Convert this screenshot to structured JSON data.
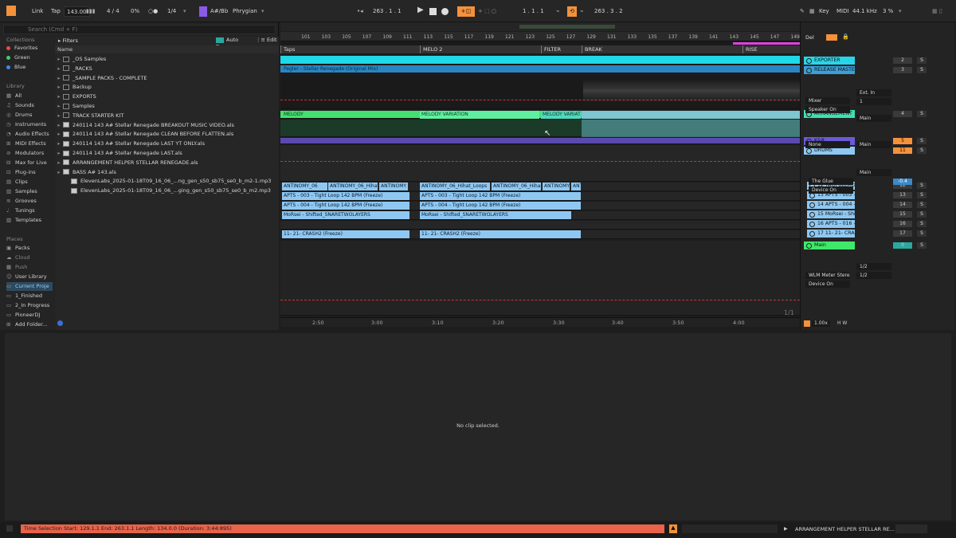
{
  "topbar": {
    "link": "Link",
    "tap": "Tap",
    "tempo": "143.00",
    "signature": "4 / 4",
    "cpu_pct": "0%",
    "quantize": "1/4",
    "key_root": "A#/Bb",
    "scale": "Phrygian",
    "song_position": "263 .  1 .  1",
    "loop_start": "1 .  1 .  1",
    "loop_length": "263 .  3 .  2",
    "key_label": "Key",
    "midi_label": "MIDI",
    "sample_rate": "44.1 kHz",
    "zoom": "3 %"
  },
  "browser": {
    "search_placeholder": "Search (Cmd + F)",
    "filters_label": "Filters",
    "auto_tags": "Auto Tags",
    "edit": "Edit",
    "name_header": "Name",
    "collections_title": "Collections",
    "collections": [
      {
        "label": "Favorites",
        "color": "#e84a4a"
      },
      {
        "label": "Green",
        "color": "#3ecf6e"
      },
      {
        "label": "Blue",
        "color": "#3c8ae8"
      }
    ],
    "library_title": "Library",
    "library": [
      "All",
      "Sounds",
      "Drums",
      "Instruments",
      "Audio Effects",
      "MIDI Effects",
      "Modulators",
      "Max for Live",
      "Plug-ins",
      "Clips",
      "Samples",
      "Grooves",
      "Tunings",
      "Templates"
    ],
    "places_title": "Places",
    "places": [
      "Packs",
      "Cloud",
      "Push",
      "User Library",
      "Current Proje",
      "1_Finished",
      "2_In Progress",
      "PioneerDJ",
      "Add Folder..."
    ],
    "files": [
      "_OS Samples",
      "_RACKS",
      "_SAMPLE PACKS - COMPLETE",
      "Backup",
      "EXPORTS",
      "Samples",
      "TRACK STARTER KIT",
      "240114 143 A# Stellar Renegade BREAKOUT MUSIC VIDEO.als",
      "240114 143 A# Stellar Renegade CLEAN BEFORE FLATTEN.als",
      "240114 143 A# Stellar Renegade LAST YT ONLY.als",
      "240114 143 A# Stellar Renegade LAST.als",
      "ARRANGEMENT HELPER STELLAR RENEGADE.als",
      "BASS A# 143.als",
      "ElevenLabs_2025-01-18T09_16_06_...ng_gen_s50_sb75_se0_b_m2-1.mp3",
      "ElevenLabs_2025-01-18T09_16_06_...ging_gen_s50_sb75_se0_b_m2.mp3"
    ]
  },
  "arrangement": {
    "bars": [
      "101",
      "103",
      "105",
      "107",
      "109",
      "111",
      "113",
      "115",
      "117",
      "119",
      "121",
      "123",
      "125",
      "127",
      "129",
      "131",
      "133",
      "135",
      "137",
      "139",
      "141",
      "143",
      "145",
      "147",
      "149"
    ],
    "locators": [
      {
        "label": "Taps"
      },
      {
        "label": "MELO 2"
      },
      {
        "label": "FILTER"
      },
      {
        "label": "BREAK"
      },
      {
        "label": "RISE"
      }
    ],
    "audio_clip": "Pegler - Stellar Renegade (Original Mix)",
    "melody_clips": [
      "MELODY",
      "MELODY VARIATION",
      "MELODY VARIAT"
    ],
    "clip_rows": [
      [
        "ANTINOMY_06",
        "ANTINOMY_06_Hihat",
        "ANTINOMY",
        "ANTINOMY_06_Hihat_Loops",
        "ANTINOMY_06_Hiha",
        "ANTINOMY",
        "ANT"
      ],
      [
        "APTS - 003 - Tight Loop 142 BPM  (Freeze)",
        "APTS - 003 - Tight Loop 142 BPM  (Freeze)"
      ],
      [
        "APTS - 004 - Tight Loop 142 BPM  (Freeze)",
        "APTS - 004 - Tight Loop 142 BPM  (Freeze)"
      ],
      [
        "MoRsei - Shifted_SNARETWOLAYERS",
        "MoRsei - Shifted_SNARETWOLAYERS"
      ],
      [
        "11- 21- CRASH2 (Freeze)",
        "11- 21- CRASH2 (Freeze)"
      ]
    ],
    "times": [
      "2:50",
      "3:00",
      "3:10",
      "3:20",
      "3:30",
      "3:40",
      "3:50",
      "4:00"
    ],
    "page": "1/1"
  },
  "mixer": {
    "del": "Del",
    "tracks": [
      {
        "name": "EXPORTER",
        "num": "2",
        "color": "#2ad4e8"
      },
      {
        "name": "RELEASE MASTE",
        "num": "3",
        "color": "#3aa0d8"
      },
      {
        "name": "ARRANGEMENT",
        "num": "4",
        "color": "#3fe0b0"
      },
      {
        "name": "K&8",
        "num": "5",
        "color": "#6a5ad8"
      },
      {
        "name": "DRUMS",
        "num": "11",
        "color": "#8ec8f2"
      },
      {
        "name": "12 TwOFULLMO",
        "num": "12",
        "color": "#8ec8f2"
      },
      {
        "name": "13 APTS - 003 -",
        "num": "13",
        "color": "#8ec8f2"
      },
      {
        "name": "14 APTS - 004 -",
        "num": "14",
        "color": "#8ec8f2"
      },
      {
        "name": "15 MoRsei - Shi",
        "num": "15",
        "color": "#8ec8f2"
      },
      {
        "name": "16 APTS - 016 -",
        "num": "16",
        "color": "#8ec8f2"
      },
      {
        "name": "17 11- 21- CRAS",
        "num": "17",
        "color": "#8ec8f2"
      },
      {
        "name": "Main",
        "num": "0",
        "color": "#3fe86a"
      }
    ],
    "devices": [
      "Mixer",
      "Speaker On",
      "None",
      "The Glue",
      "Device On",
      "WLM Meter Stere",
      "Device On"
    ],
    "routing": [
      "Ext. In",
      "1",
      "Main",
      "Main",
      "Main",
      "1/2",
      "1/2"
    ],
    "vol_drums": "-0.4",
    "scale": "1.00x"
  },
  "detail": {
    "empty": "No clip selected."
  },
  "status": {
    "selection": "Time Selection   Start: 129.1.1   End: 263.1.1   Length: 134.0.0  (Duration: 3:44:895)",
    "set_name": "ARRANGEMENT HELPER STELLAR RE..."
  }
}
